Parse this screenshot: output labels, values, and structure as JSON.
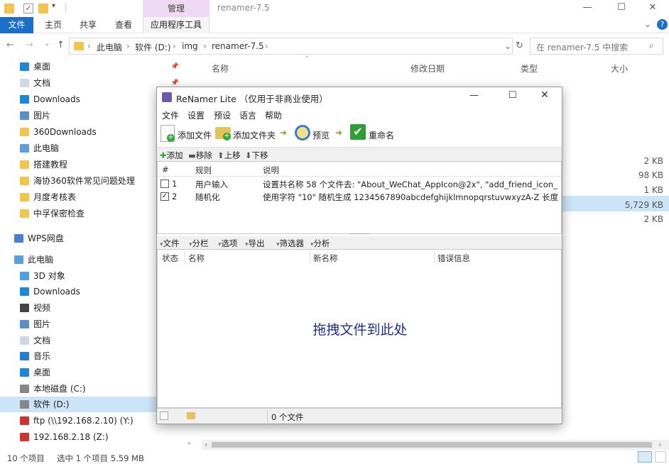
{
  "titlebar": {
    "context_tab": "管理",
    "window_title": "renamer-7.5",
    "min": "—",
    "max": "☐",
    "close": "✕"
  },
  "ribbon": {
    "file": "文件",
    "tabs": [
      "主页",
      "共享",
      "查看"
    ],
    "apptools": "应用程序工具",
    "expand": "⌄",
    "help": "?"
  },
  "address": {
    "crumbs": [
      "此电脑",
      "软件 (D:)",
      "img",
      "renamer-7.5"
    ],
    "dropdown": "⌄",
    "refresh": "↻",
    "search_placeholder": "在 renamer-7.5 中搜索"
  },
  "nav": [
    {
      "label": "桌面",
      "icon": "desktop-icon",
      "color": "#1e88d8",
      "pin": true
    },
    {
      "label": "文档",
      "icon": "document-icon",
      "color": "#cfd8e3",
      "pin": true
    },
    {
      "label": "Downloads",
      "icon": "download-icon",
      "color": "#1e88d8",
      "pin": true
    },
    {
      "label": "图片",
      "icon": "picture-icon",
      "color": "#5b8fc9",
      "pin": true
    },
    {
      "label": "360Downloads",
      "icon": "folder-icon",
      "color": "#f2c44d",
      "pin": false
    },
    {
      "label": "此电脑",
      "icon": "computer-icon",
      "color": "#5aa0dd",
      "pin": false
    },
    {
      "label": "搭建教程",
      "icon": "folder-icon",
      "color": "#f2c44d",
      "pin": false
    },
    {
      "label": "海协360软件常见问题处理",
      "icon": "folder-icon",
      "color": "#f2c44d",
      "pin": false
    },
    {
      "label": "月度考核表",
      "icon": "folder-icon",
      "color": "#f2c44d",
      "pin": false
    },
    {
      "label": "中孚保密检查",
      "icon": "folder-icon",
      "color": "#f2c44d",
      "pin": false
    }
  ],
  "nav2": [
    {
      "label": "WPS网盘",
      "icon": "cloud-icon",
      "color": "#4a7fd0"
    }
  ],
  "nav3": [
    {
      "label": "此电脑",
      "icon": "computer-icon",
      "color": "#5aa0dd"
    },
    {
      "label": "3D 对象",
      "icon": "3d-objects-icon",
      "color": "#4aa3e0"
    },
    {
      "label": "Downloads",
      "icon": "download-icon",
      "color": "#1e88d8"
    },
    {
      "label": "视频",
      "icon": "video-icon",
      "color": "#444"
    },
    {
      "label": "图片",
      "icon": "picture-icon",
      "color": "#5b8fc9"
    },
    {
      "label": "文档",
      "icon": "document-icon",
      "color": "#cfd8e3"
    },
    {
      "label": "音乐",
      "icon": "music-icon",
      "color": "#2b7bd1"
    },
    {
      "label": "桌面",
      "icon": "desktop-icon",
      "color": "#1e88d8"
    },
    {
      "label": "本地磁盘 (C:)",
      "icon": "drive-icon",
      "color": "#888"
    },
    {
      "label": "软件 (D:)",
      "icon": "drive-icon",
      "color": "#888"
    },
    {
      "label": "ftp (\\\\192.168.2.10) (Y:)",
      "icon": "network-drive-icon",
      "color": "#c33"
    },
    {
      "label": "192.168.2.18 (Z:)",
      "icon": "network-drive-icon",
      "color": "#c33"
    }
  ],
  "list": {
    "headers": [
      "名称",
      "修改日期",
      "类型",
      "大小"
    ],
    "sizes": [
      "2 KB",
      "98 KB",
      "1 KB",
      "5,729 KB",
      "2 KB"
    ]
  },
  "status": {
    "count": "10 个项目",
    "selected": "选中 1 个项目  5.59 MB"
  },
  "dialog": {
    "title": "ReNamer Lite （仅用于非商业使用）",
    "menu": [
      "文件",
      "设置",
      "预设",
      "语言",
      "帮助"
    ],
    "toolbar": {
      "add_files": "添加文件",
      "add_folder": "添加文件夹",
      "preview": "预览",
      "rename": "重命名"
    },
    "rules_toolbar": [
      "添加",
      "移除",
      "上移",
      "下移"
    ],
    "rules_headers": [
      "#",
      "规则",
      "说明"
    ],
    "rules": [
      {
        "checked": false,
        "num": "1",
        "rule": "用户输入",
        "desc": "设置共名称 58 个文件去: \"About_WeChat_AppIcon@2x\", \"add_friend_icon_..."
      },
      {
        "checked": true,
        "num": "2",
        "rule": "随机化",
        "desc": "使用字符 \"10\" 随机生成 1234567890abcdefghijklmnopqrstuvwxyzA-Z 长度..."
      }
    ],
    "files_toolbar": [
      "文件",
      "分栏",
      "选项",
      "导出",
      "筛选器",
      "分析"
    ],
    "files_headers": [
      "状态",
      "名称",
      "新名称",
      "错误信息"
    ],
    "drop_hint": "拖拽文件到此处",
    "status_files": "0 个文件"
  }
}
